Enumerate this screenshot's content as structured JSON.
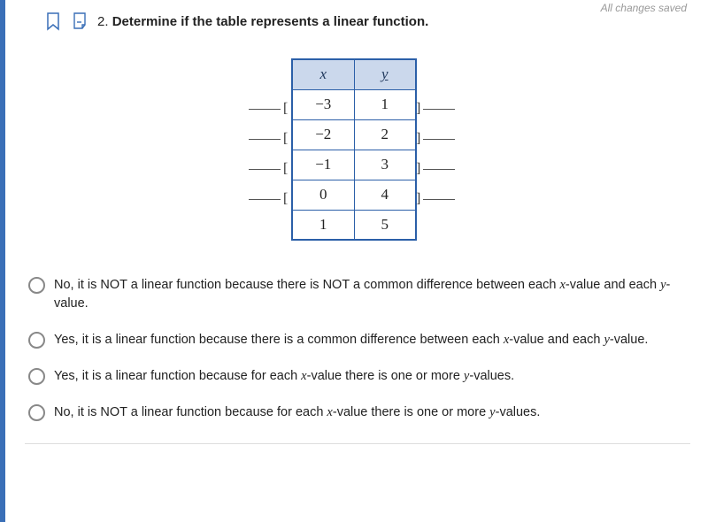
{
  "status": {
    "saved_text": "All changes saved"
  },
  "question": {
    "number": "2.",
    "prompt": "Determine if the table represents a linear function."
  },
  "table": {
    "header_x": "x",
    "header_y": "y",
    "rows": [
      {
        "x": "−3",
        "y": "1"
      },
      {
        "x": "−2",
        "y": "2"
      },
      {
        "x": "−1",
        "y": "3"
      },
      {
        "x": "0",
        "y": "4"
      },
      {
        "x": "1",
        "y": "5"
      }
    ]
  },
  "options": [
    {
      "pre": "No, it is NOT a linear function because there is NOT a common difference between each ",
      "var1": "x",
      "mid": "-value and each ",
      "var2": "y",
      "post": "-value."
    },
    {
      "pre": "Yes, it is a linear function because there is a common difference between each ",
      "var1": "x",
      "mid": "-value and each ",
      "var2": "y",
      "post": "-value."
    },
    {
      "pre": "Yes, it is a linear function because for each ",
      "var1": "x",
      "mid": "-value there is one or more ",
      "var2": "y",
      "post": "-values."
    },
    {
      "pre": "No, it is NOT a linear function because for each ",
      "var1": "x",
      "mid": "-value there is one or more ",
      "var2": "y",
      "post": "-values."
    }
  ]
}
